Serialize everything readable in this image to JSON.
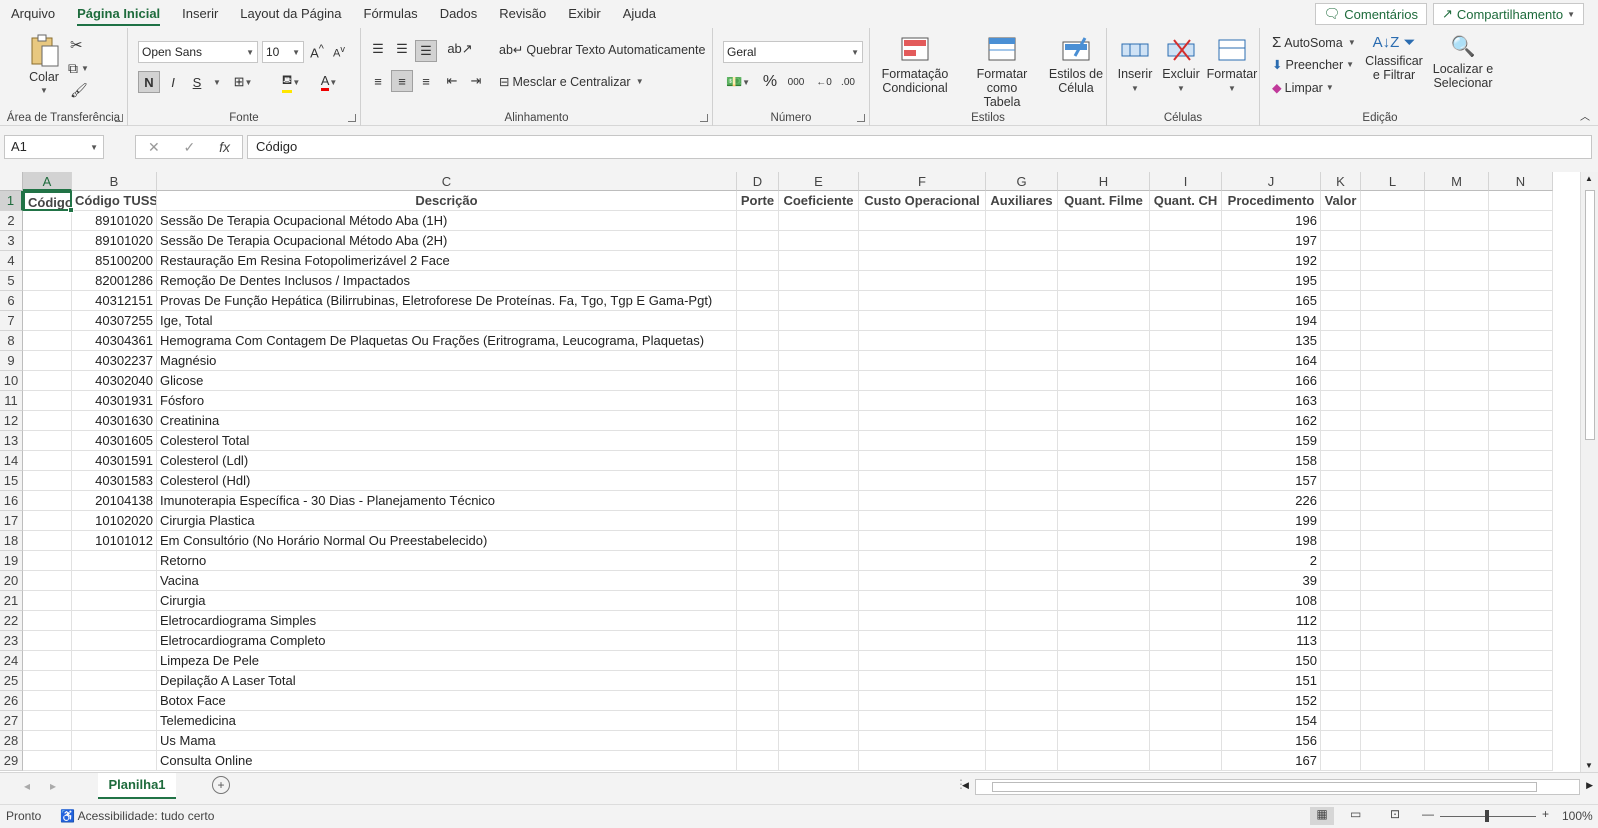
{
  "menu": {
    "tabs": [
      "Arquivo",
      "Página Inicial",
      "Inserir",
      "Layout da Página",
      "Fórmulas",
      "Dados",
      "Revisão",
      "Exibir",
      "Ajuda"
    ],
    "comments_label": "Comentários",
    "share_label": "Compartilhamento"
  },
  "ribbon": {
    "clipboard": {
      "paste_label": "Colar",
      "group_label": "Área de Transferência"
    },
    "font": {
      "font_name": "Open Sans",
      "font_size": "10",
      "bold": "N",
      "italic": "I",
      "underline": "S",
      "group_label": "Fonte"
    },
    "alignment": {
      "wrap_label": "Quebrar Texto Automaticamente",
      "merge_label": "Mesclar e Centralizar",
      "group_label": "Alinhamento"
    },
    "number": {
      "format": "Geral",
      "percent": "%",
      "thousands": "000",
      "group_label": "Número"
    },
    "styles": {
      "conditional_label": "Formatação\nCondicional",
      "table_label": "Formatar como\nTabela",
      "cell_styles_label": "Estilos de\nCélula",
      "group_label": "Estilos"
    },
    "cells": {
      "insert_label": "Inserir",
      "delete_label": "Excluir",
      "format_label": "Formatar",
      "group_label": "Células"
    },
    "editing": {
      "autosum_label": "AutoSoma",
      "fill_label": "Preencher",
      "clear_label": "Limpar",
      "sort_label": "Classificar\ne Filtrar",
      "find_label": "Localizar e\nSelecionar",
      "group_label": "Edição"
    }
  },
  "formula_bar": {
    "name_box": "A1",
    "formula": "Código",
    "fx": "fx"
  },
  "sheet": {
    "columns": [
      "A",
      "B",
      "C",
      "D",
      "E",
      "F",
      "G",
      "H",
      "I",
      "J",
      "K",
      "L",
      "M",
      "N"
    ],
    "headers": [
      "Código",
      "Código TUSS",
      "Descrição",
      "Porte",
      "Coeficiente",
      "Custo Operacional",
      "Auxiliares",
      "Quant. Filme",
      "Quant. CH",
      "Procedimento",
      "Valor"
    ],
    "rows": [
      {
        "b": "89101020",
        "c": "Sessão De Terapia Ocupacional Método Aba (1H)",
        "j": "196"
      },
      {
        "b": "89101020",
        "c": "Sessão De Terapia Ocupacional Método Aba (2H)",
        "j": "197"
      },
      {
        "b": "85100200",
        "c": "Restauração Em Resina Fotopolimerizável 2 Face",
        "j": "192"
      },
      {
        "b": "82001286",
        "c": "Remoção De Dentes Inclusos / Impactados",
        "j": "195"
      },
      {
        "b": "40312151",
        "c": "Provas De Função Hepática (Bilirrubinas, Eletroforese De Proteínas. Fa, Tgo, Tgp E Gama-Pgt)",
        "j": "165"
      },
      {
        "b": "40307255",
        "c": "Ige, Total",
        "j": "194"
      },
      {
        "b": "40304361",
        "c": "Hemograma Com Contagem De Plaquetas Ou Frações (Eritrograma, Leucograma, Plaquetas)",
        "j": "135"
      },
      {
        "b": "40302237",
        "c": "Magnésio",
        "j": "164"
      },
      {
        "b": "40302040",
        "c": "Glicose",
        "j": "166"
      },
      {
        "b": "40301931",
        "c": "Fósforo",
        "j": "163"
      },
      {
        "b": "40301630",
        "c": "Creatinina",
        "j": "162"
      },
      {
        "b": "40301605",
        "c": "Colesterol Total",
        "j": "159"
      },
      {
        "b": "40301591",
        "c": "Colesterol (Ldl)",
        "j": "158"
      },
      {
        "b": "40301583",
        "c": "Colesterol (Hdl)",
        "j": "157"
      },
      {
        "b": "20104138",
        "c": "Imunoterapia Específica - 30 Dias - Planejamento Técnico",
        "j": "226"
      },
      {
        "b": "10102020",
        "c": "Cirurgia Plastica",
        "j": "199"
      },
      {
        "b": "10101012",
        "c": "Em Consultório (No Horário Normal Ou Preestabelecido)",
        "j": "198"
      },
      {
        "b": "",
        "c": "Retorno",
        "j": "2"
      },
      {
        "b": "",
        "c": "Vacina",
        "j": "39"
      },
      {
        "b": "",
        "c": "Cirurgia",
        "j": "108"
      },
      {
        "b": "",
        "c": "Eletrocardiograma Simples",
        "j": "112"
      },
      {
        "b": "",
        "c": "Eletrocardiograma Completo",
        "j": "113"
      },
      {
        "b": "",
        "c": "Limpeza De Pele",
        "j": "150"
      },
      {
        "b": "",
        "c": "Depilação A Laser Total",
        "j": "151"
      },
      {
        "b": "",
        "c": "Botox Face",
        "j": "152"
      },
      {
        "b": "",
        "c": "Telemedicina",
        "j": "154"
      },
      {
        "b": "",
        "c": "Us Mama",
        "j": "156"
      },
      {
        "b": "",
        "c": "Consulta Online",
        "j": "167"
      }
    ],
    "tab_name": "Planilha1"
  },
  "status": {
    "ready": "Pronto",
    "accessibility": "Acessibilidade: tudo certo",
    "zoom": "100%"
  }
}
